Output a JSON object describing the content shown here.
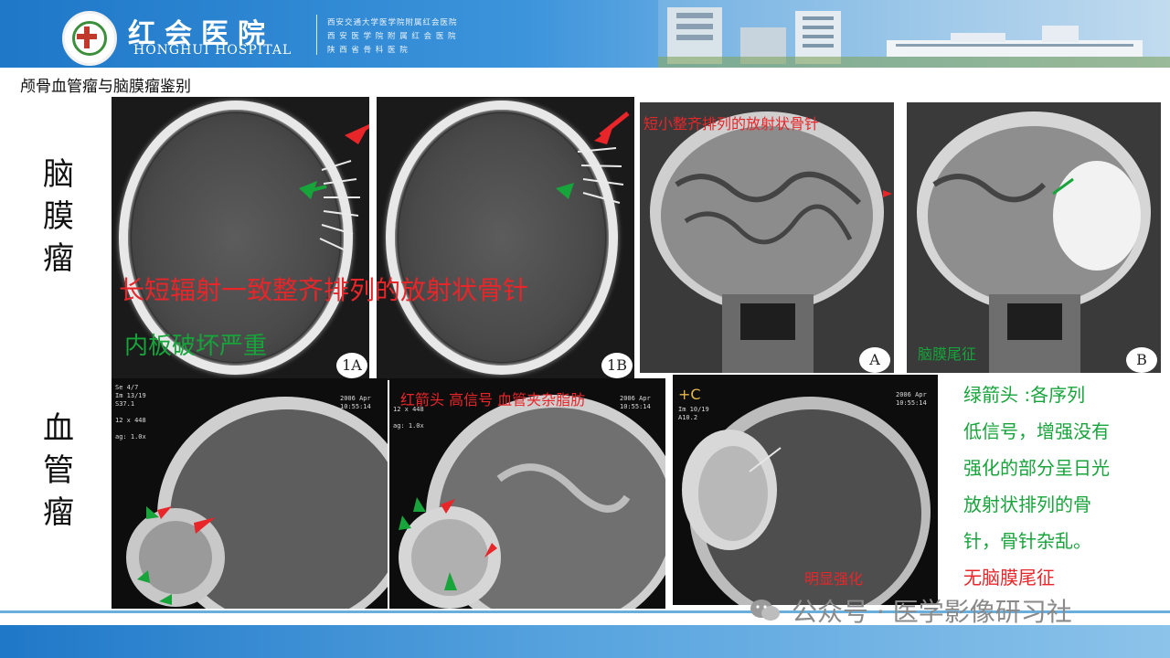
{
  "header": {
    "hospital_cn": "红会医院",
    "hospital_en": "HONGHUI HOSPITAL",
    "affiliations": [
      "西安交通大学医学院附属红会医院",
      "西 安 医 学 院 附 属 红 会 医 院",
      "陕 西 省 骨 科 医 院"
    ]
  },
  "page_title": "颅骨血管瘤与脑膜瘤鉴别",
  "side_labels": {
    "meningioma": "脑膜瘤",
    "hemangioma": "血管瘤"
  },
  "panels": {
    "ct_1a_label": "1A",
    "ct_1b_label": "1B",
    "mri_a_label": "A",
    "mri_b_label": "B",
    "mri_a_caption": "短小整齐排列的放射状骨针",
    "mri_b_caption": "脑膜尾征",
    "hem2_caption": "红箭头 高信号 血管夹杂脂肪",
    "hem3_tag": "+C",
    "hem3_caption": "明显强化"
  },
  "overlays": {
    "radial_spicules": "长短辐射一致整齐排列的放射状骨针",
    "inner_table": "内板破坏严重"
  },
  "description": {
    "lines": [
      "绿箭头 :各序列",
      "低信号，增强没有",
      "强化的部分呈日光",
      "放射状排列的骨",
      "针，骨针杂乱。"
    ],
    "no_tail": "无脑膜尾征"
  },
  "dicom_text": {
    "p1": [
      "Se 4/7",
      "Im 13/19",
      "S37.1",
      "",
      "12 x 448",
      "",
      "ag: 1.0x"
    ],
    "p1_right": [
      "2006 Apr",
      "10:55:14"
    ],
    "p2": [
      "12 x 448",
      "",
      "ag: 1.0x"
    ],
    "p2_right": [
      "2006 Apr",
      "10:55:14"
    ],
    "p3": [
      "Im 10/19",
      "A10.2"
    ],
    "p3_right": [
      "2006 Apr",
      "10:55:14"
    ]
  },
  "watermark": "公众号 · 医学影像研习社",
  "colors": {
    "header_blue": "#1f78c8",
    "annotation_red": "#e8262a",
    "annotation_green": "#17a43b"
  }
}
